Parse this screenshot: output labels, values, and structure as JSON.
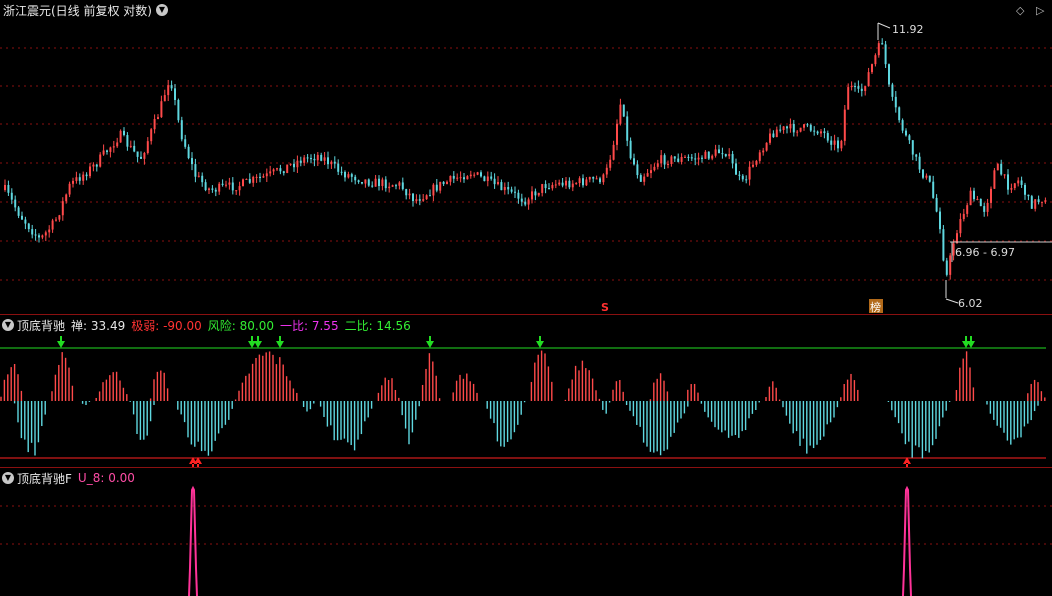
{
  "main": {
    "title": "浙江震元(日线 前复权 对数)",
    "high_label": "11.92",
    "low_label": "6.02",
    "range_label": "6.96 - 6.97",
    "marker_s": "S",
    "marker_bang": "榜"
  },
  "ind1": {
    "name": "顶底背驰",
    "items": [
      {
        "key": "禅",
        "value": "33.49",
        "color": "#e6e6e6"
      },
      {
        "key": "极弱",
        "value": "-90.00",
        "color": "#ff3333"
      },
      {
        "key": "风险",
        "value": "80.00",
        "color": "#33ee33"
      },
      {
        "key": "一比",
        "value": "7.55",
        "color": "#ee33ee"
      },
      {
        "key": "二比",
        "value": "14.56",
        "color": "#33ee33"
      }
    ]
  },
  "ind2": {
    "name": "顶底背驰F",
    "key": "U_8",
    "value": "0.00"
  },
  "colors": {
    "up": "#ff4a4a",
    "down": "#5fd8e0",
    "grid": "#8a1010",
    "green_line": "#22dd22",
    "red_line": "#ff2222",
    "spike": "#ff3399"
  }
}
